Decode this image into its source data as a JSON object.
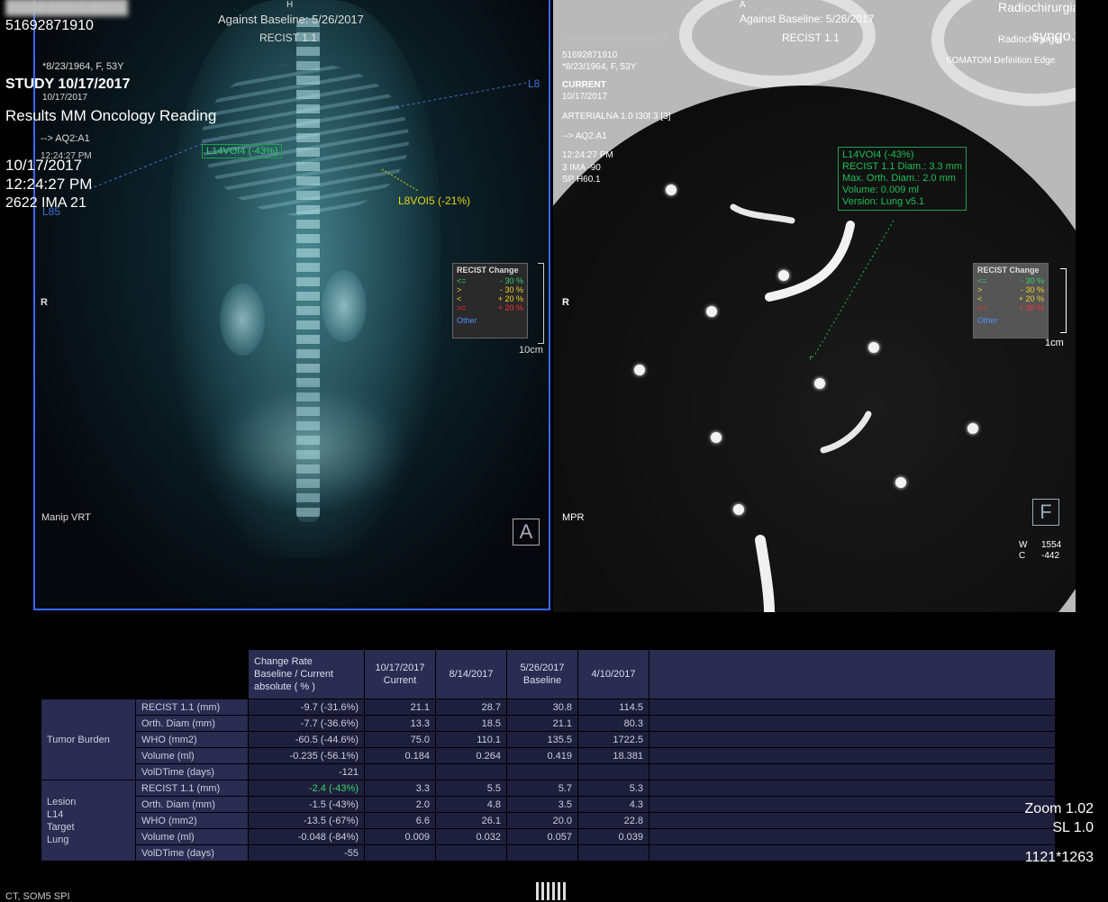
{
  "header": {
    "patient_id": "51692871910",
    "orientation_top_left": "H",
    "orientation_top_right": "A",
    "baseline_text": "Against Baseline: 5/26/2017",
    "recist_label": "RECIST 1.1",
    "brand": "Radiochirurgia",
    "product": "syngo.via",
    "scanner": "SOMATOM Definition Edge"
  },
  "left_view": {
    "patient_info": "*8/23/1964, F, 53Y",
    "study": "STUDY 10/17/2017",
    "study_date_small": "10/17/2017",
    "results_label": "Results MM Oncology Reading",
    "arrow_info": "--> AQ2:A1",
    "time_small": "12:24:27 PM",
    "date": "10/17/2017",
    "time": "12:24:27 PM",
    "image_info": "2622 IMA 21",
    "lesion_tag_1": "L14VOI4 (-43%)",
    "lesion_tag_2": "L8VOI5 (-21%)",
    "lesion_tag_3": "L8",
    "lesion_tag_4": "L85",
    "orientation_left": "R",
    "mode": "Manip VRT",
    "scale": "10cm",
    "view_letter": "A"
  },
  "right_view": {
    "patient_id": "51692871910",
    "patient_info": "*8/23/1964, F, 53Y",
    "current": "CURRENT",
    "date": "10/17/2017",
    "series": "ARTERIALNA 1.0 I30f 3 [3]",
    "arrow_info": "--> AQ2:A1",
    "time": "12:24:27 PM",
    "ima": "3 IMA -90",
    "sp": "SP H60.1",
    "orientation_left": "R",
    "mode": "MPR",
    "scale": "1cm",
    "view_letter": "F",
    "window_w_label": "W",
    "window_w": "1554",
    "window_c_label": "C",
    "window_c": "-442",
    "measurement": [
      "L14VOI4 (-43%)",
      "RECIST 1.1 Diam.: 3.3 mm",
      "Max. Orth. Diam.: 2.0 mm",
      "Volume: 0.009 ml",
      "Version: Lung v5.1"
    ]
  },
  "recist_legend": {
    "title": "RECIST Change",
    "rows": [
      {
        "sym": "<=",
        "val": "- 30 %",
        "color": "#37d06a"
      },
      {
        "sym": ">",
        "val": "- 30 %",
        "color": "#f0d02a"
      },
      {
        "sym": "<",
        "val": "+ 20 %",
        "color": "#f0d02a"
      },
      {
        "sym": ">=",
        "val": "+ 20 %",
        "color": "#ff3030"
      }
    ],
    "other": "Other"
  },
  "table": {
    "headers": [
      "Change Rate\nBaseline / Current\nabsolute ( % )",
      "10/17/2017\nCurrent",
      "8/14/2017",
      "5/26/2017\nBaseline",
      "4/10/2017"
    ],
    "groups": [
      {
        "name": "Tumor Burden",
        "rows": [
          {
            "label": "RECIST 1.1 (mm)",
            "change": "-9.7 (-31.6%)",
            "values": [
              "21.1",
              "28.7",
              "30.8",
              "114.5"
            ]
          },
          {
            "label": "Orth. Diam (mm)",
            "change": "-7.7 (-36.6%)",
            "values": [
              "13.3",
              "18.5",
              "21.1",
              "80.3"
            ]
          },
          {
            "label": "WHO (mm2)",
            "change": "-60.5 (-44.6%)",
            "values": [
              "75.0",
              "110.1",
              "135.5",
              "1722.5"
            ]
          },
          {
            "label": "Volume (ml)",
            "change": "-0.235 (-56.1%)",
            "values": [
              "0.184",
              "0.264",
              "0.419",
              "18.381"
            ]
          },
          {
            "label": "VolDTime (days)",
            "change": "-121",
            "values": [
              "",
              "",
              "",
              ""
            ]
          }
        ]
      },
      {
        "name": "Lesion\nL14\nTarget\nLung",
        "rows": [
          {
            "label": "RECIST 1.1 (mm)",
            "change": "-2.4 (-43%)",
            "values": [
              "3.3",
              "5.5",
              "5.7",
              "5.3"
            ]
          },
          {
            "label": "Orth. Diam (mm)",
            "change": "-1.5 (-43%)",
            "values": [
              "2.0",
              "4.8",
              "3.5",
              "4.3"
            ]
          },
          {
            "label": "WHO (mm2)",
            "change": "-13.5 (-67%)",
            "values": [
              "6.6",
              "26.1",
              "20.0",
              "22.8"
            ]
          },
          {
            "label": "Volume (ml)",
            "change": "-0.048 (-84%)",
            "values": [
              "0.009",
              "0.032",
              "0.057",
              "0.039"
            ]
          },
          {
            "label": "VolDTime (days)",
            "change": "-55",
            "values": [
              "",
              "",
              "",
              ""
            ]
          }
        ]
      }
    ]
  },
  "footer": {
    "zoom": "Zoom 1.02",
    "sl": "SL 1.0",
    "dims": "1121*1263",
    "bottom_left": "CT, SOM5 SPI"
  }
}
